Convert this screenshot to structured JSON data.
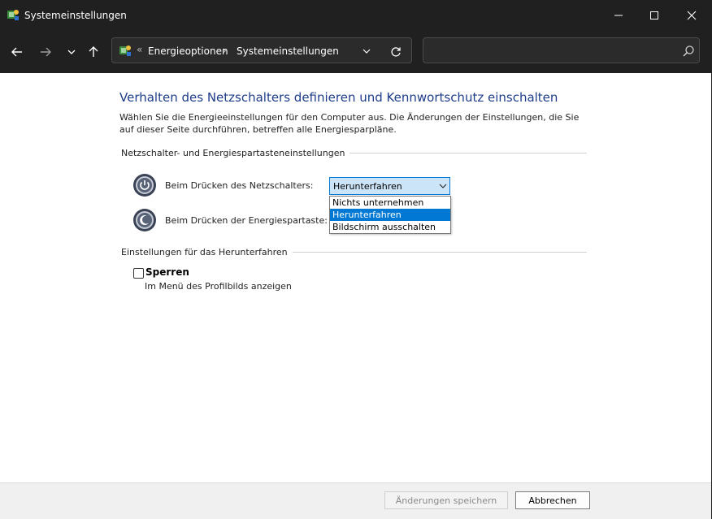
{
  "window": {
    "title": "Systemeinstellungen"
  },
  "address": {
    "prefix": "«",
    "crumbs": [
      "Energieoptionen",
      "Systemeinstellungen"
    ],
    "separator": "›"
  },
  "search": {
    "value": "",
    "placeholder": ""
  },
  "content": {
    "heading": "Verhalten des Netzschalters definieren und Kennwortschutz einschalten",
    "description": "Wählen Sie die Energieeinstellungen für den Computer aus. Die Änderungen der Einstellungen, die Sie auf dieser Seite durchführen, betreffen alle Energiesparpläne.",
    "section_power": "Netzschalter- und Energiespartasteneinstellungen",
    "power_button_label": "Beim Drücken des Netzschalters:",
    "sleep_button_label": "Beim Drücken der Energiespartaste:",
    "power_select_value": "Herunterfahren",
    "power_options": [
      "Nichts unternehmen",
      "Herunterfahren",
      "Bildschirm ausschalten"
    ],
    "selected_option_index": 1,
    "section_shutdown": "Einstellungen für das Herunterfahren",
    "lock_label": "Sperren",
    "lock_sublabel": "Im Menü des Profilbilds anzeigen",
    "lock_checked": false
  },
  "footer": {
    "save_label": "Änderungen speichern",
    "cancel_label": "Abbrechen"
  },
  "colors": {
    "heading": "#1e3d8a",
    "accent": "#0078d4",
    "titlebar": "#202020"
  }
}
